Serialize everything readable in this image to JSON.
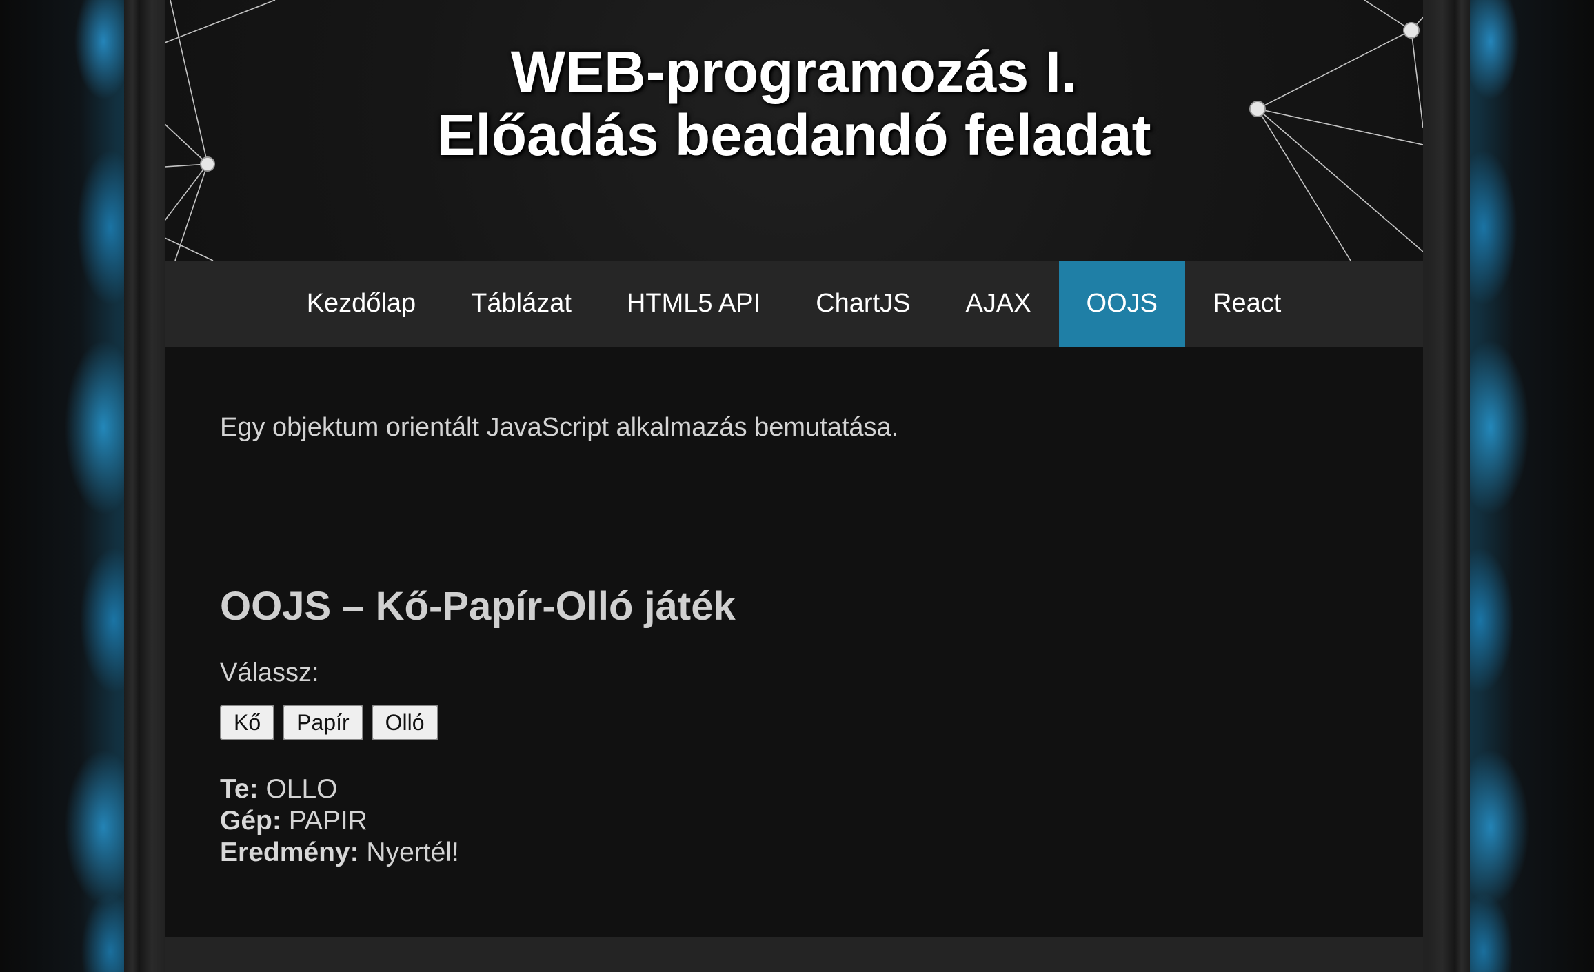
{
  "header": {
    "title_line1": "WEB-programozás I.",
    "title_line2": "Előadás beadandó feladat"
  },
  "nav": {
    "items": [
      {
        "label": "Kezdőlap"
      },
      {
        "label": "Táblázat"
      },
      {
        "label": "HTML5 API"
      },
      {
        "label": "ChartJS"
      },
      {
        "label": "AJAX"
      },
      {
        "label": "OOJS",
        "active": true
      },
      {
        "label": "React"
      }
    ]
  },
  "main": {
    "intro": "Egy objektum orientált JavaScript alkalmazás bemutatása.",
    "game_title": "OOJS – Kő-Papír-Olló játék",
    "choose_label": "Válassz:",
    "buttons": {
      "rock": "Kő",
      "paper": "Papír",
      "scissors": "Olló"
    },
    "results": {
      "you_label": "Te:",
      "you_value": "OLLO",
      "machine_label": "Gép:",
      "machine_value": "PAPIR",
      "result_label": "Eredmény:",
      "result_value": "Nyertél!"
    }
  },
  "colors": {
    "accent": "#1f7fa6",
    "content_bg": "#111111",
    "nav_bg": "#262626"
  }
}
